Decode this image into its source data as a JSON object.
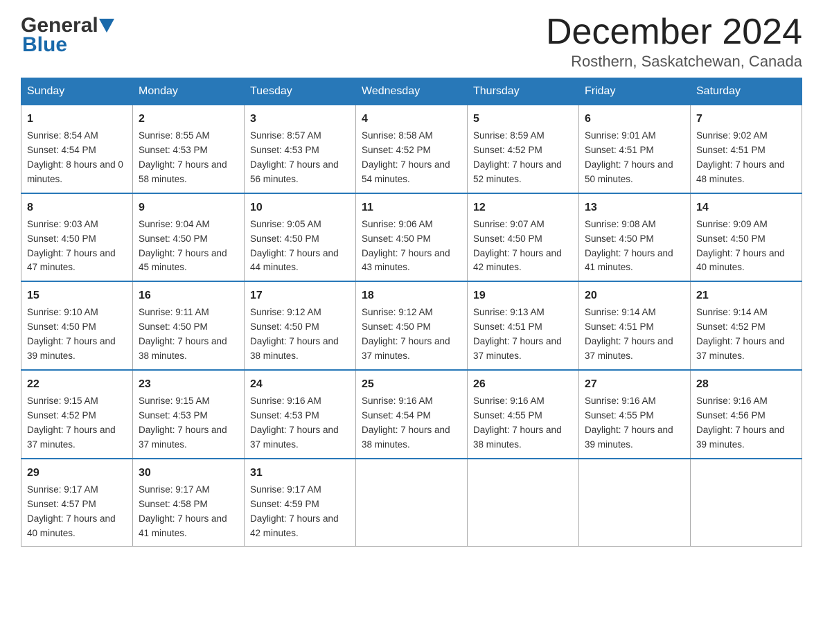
{
  "header": {
    "logo_general": "General",
    "logo_blue": "Blue",
    "month_title": "December 2024",
    "location": "Rosthern, Saskatchewan, Canada"
  },
  "days_of_week": [
    "Sunday",
    "Monday",
    "Tuesday",
    "Wednesday",
    "Thursday",
    "Friday",
    "Saturday"
  ],
  "weeks": [
    [
      {
        "num": "1",
        "sunrise": "8:54 AM",
        "sunset": "4:54 PM",
        "daylight": "8 hours and 0 minutes"
      },
      {
        "num": "2",
        "sunrise": "8:55 AM",
        "sunset": "4:53 PM",
        "daylight": "7 hours and 58 minutes"
      },
      {
        "num": "3",
        "sunrise": "8:57 AM",
        "sunset": "4:53 PM",
        "daylight": "7 hours and 56 minutes"
      },
      {
        "num": "4",
        "sunrise": "8:58 AM",
        "sunset": "4:52 PM",
        "daylight": "7 hours and 54 minutes"
      },
      {
        "num": "5",
        "sunrise": "8:59 AM",
        "sunset": "4:52 PM",
        "daylight": "7 hours and 52 minutes"
      },
      {
        "num": "6",
        "sunrise": "9:01 AM",
        "sunset": "4:51 PM",
        "daylight": "7 hours and 50 minutes"
      },
      {
        "num": "7",
        "sunrise": "9:02 AM",
        "sunset": "4:51 PM",
        "daylight": "7 hours and 48 minutes"
      }
    ],
    [
      {
        "num": "8",
        "sunrise": "9:03 AM",
        "sunset": "4:50 PM",
        "daylight": "7 hours and 47 minutes"
      },
      {
        "num": "9",
        "sunrise": "9:04 AM",
        "sunset": "4:50 PM",
        "daylight": "7 hours and 45 minutes"
      },
      {
        "num": "10",
        "sunrise": "9:05 AM",
        "sunset": "4:50 PM",
        "daylight": "7 hours and 44 minutes"
      },
      {
        "num": "11",
        "sunrise": "9:06 AM",
        "sunset": "4:50 PM",
        "daylight": "7 hours and 43 minutes"
      },
      {
        "num": "12",
        "sunrise": "9:07 AM",
        "sunset": "4:50 PM",
        "daylight": "7 hours and 42 minutes"
      },
      {
        "num": "13",
        "sunrise": "9:08 AM",
        "sunset": "4:50 PM",
        "daylight": "7 hours and 41 minutes"
      },
      {
        "num": "14",
        "sunrise": "9:09 AM",
        "sunset": "4:50 PM",
        "daylight": "7 hours and 40 minutes"
      }
    ],
    [
      {
        "num": "15",
        "sunrise": "9:10 AM",
        "sunset": "4:50 PM",
        "daylight": "7 hours and 39 minutes"
      },
      {
        "num": "16",
        "sunrise": "9:11 AM",
        "sunset": "4:50 PM",
        "daylight": "7 hours and 38 minutes"
      },
      {
        "num": "17",
        "sunrise": "9:12 AM",
        "sunset": "4:50 PM",
        "daylight": "7 hours and 38 minutes"
      },
      {
        "num": "18",
        "sunrise": "9:12 AM",
        "sunset": "4:50 PM",
        "daylight": "7 hours and 37 minutes"
      },
      {
        "num": "19",
        "sunrise": "9:13 AM",
        "sunset": "4:51 PM",
        "daylight": "7 hours and 37 minutes"
      },
      {
        "num": "20",
        "sunrise": "9:14 AM",
        "sunset": "4:51 PM",
        "daylight": "7 hours and 37 minutes"
      },
      {
        "num": "21",
        "sunrise": "9:14 AM",
        "sunset": "4:52 PM",
        "daylight": "7 hours and 37 minutes"
      }
    ],
    [
      {
        "num": "22",
        "sunrise": "9:15 AM",
        "sunset": "4:52 PM",
        "daylight": "7 hours and 37 minutes"
      },
      {
        "num": "23",
        "sunrise": "9:15 AM",
        "sunset": "4:53 PM",
        "daylight": "7 hours and 37 minutes"
      },
      {
        "num": "24",
        "sunrise": "9:16 AM",
        "sunset": "4:53 PM",
        "daylight": "7 hours and 37 minutes"
      },
      {
        "num": "25",
        "sunrise": "9:16 AM",
        "sunset": "4:54 PM",
        "daylight": "7 hours and 38 minutes"
      },
      {
        "num": "26",
        "sunrise": "9:16 AM",
        "sunset": "4:55 PM",
        "daylight": "7 hours and 38 minutes"
      },
      {
        "num": "27",
        "sunrise": "9:16 AM",
        "sunset": "4:55 PM",
        "daylight": "7 hours and 39 minutes"
      },
      {
        "num": "28",
        "sunrise": "9:16 AM",
        "sunset": "4:56 PM",
        "daylight": "7 hours and 39 minutes"
      }
    ],
    [
      {
        "num": "29",
        "sunrise": "9:17 AM",
        "sunset": "4:57 PM",
        "daylight": "7 hours and 40 minutes"
      },
      {
        "num": "30",
        "sunrise": "9:17 AM",
        "sunset": "4:58 PM",
        "daylight": "7 hours and 41 minutes"
      },
      {
        "num": "31",
        "sunrise": "9:17 AM",
        "sunset": "4:59 PM",
        "daylight": "7 hours and 42 minutes"
      },
      null,
      null,
      null,
      null
    ]
  ],
  "labels": {
    "sunrise": "Sunrise:",
    "sunset": "Sunset:",
    "daylight": "Daylight:"
  }
}
